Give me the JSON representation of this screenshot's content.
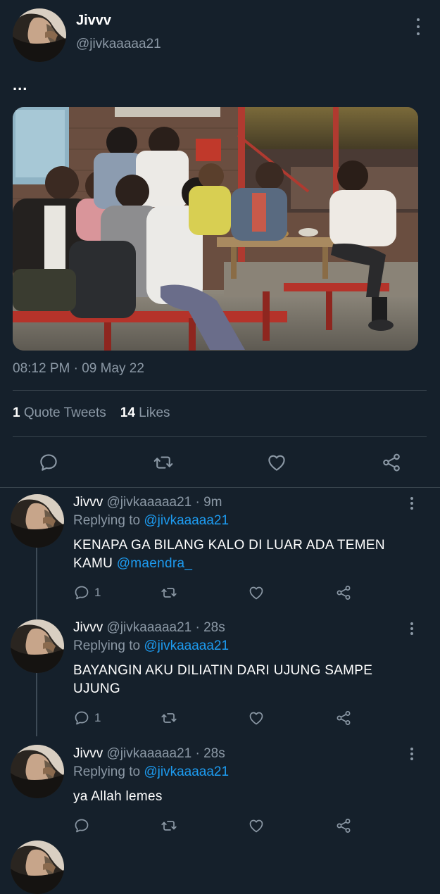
{
  "main_tweet": {
    "name": "Jivvv",
    "handle": "@jivkaaaaa21",
    "text": "...",
    "timestamp": "08:12 PM · 09 May 22",
    "stats": {
      "quote_count": "1",
      "quote_label": "Quote Tweets",
      "like_count": "14",
      "like_label": "Likes"
    }
  },
  "replies": [
    {
      "name": "Jivvv",
      "handle_time": "@jivkaaaaa21 · 9m",
      "replying_prefix": "Replying to",
      "replying_to": "@jivkaaaaa21",
      "text": "KENAPA GA BILANG KALO DI LUAR ADA TEMEN KAMU",
      "mention": "@maendra_",
      "reply_count": "1"
    },
    {
      "name": "Jivvv",
      "handle_time": "@jivkaaaaa21 · 28s",
      "replying_prefix": "Replying to",
      "replying_to": "@jivkaaaaa21",
      "text": "BAYANGIN AKU DILIATIN DARI UJUNG SAMPE UJUNG",
      "reply_count": "1"
    },
    {
      "name": "Jivvv",
      "handle_time": "@jivkaaaaa21 · 28s",
      "replying_prefix": "Replying to",
      "replying_to": "@jivkaaaaa21",
      "text": "ya Allah lemes"
    }
  ],
  "colors": {
    "background": "#15202b",
    "accent_link": "#1d9bf0",
    "secondary_text": "#8b98a5",
    "divider": "#38444d"
  },
  "icons": [
    "reply-icon",
    "retweet-icon",
    "like-icon",
    "share-icon",
    "more-icon"
  ]
}
